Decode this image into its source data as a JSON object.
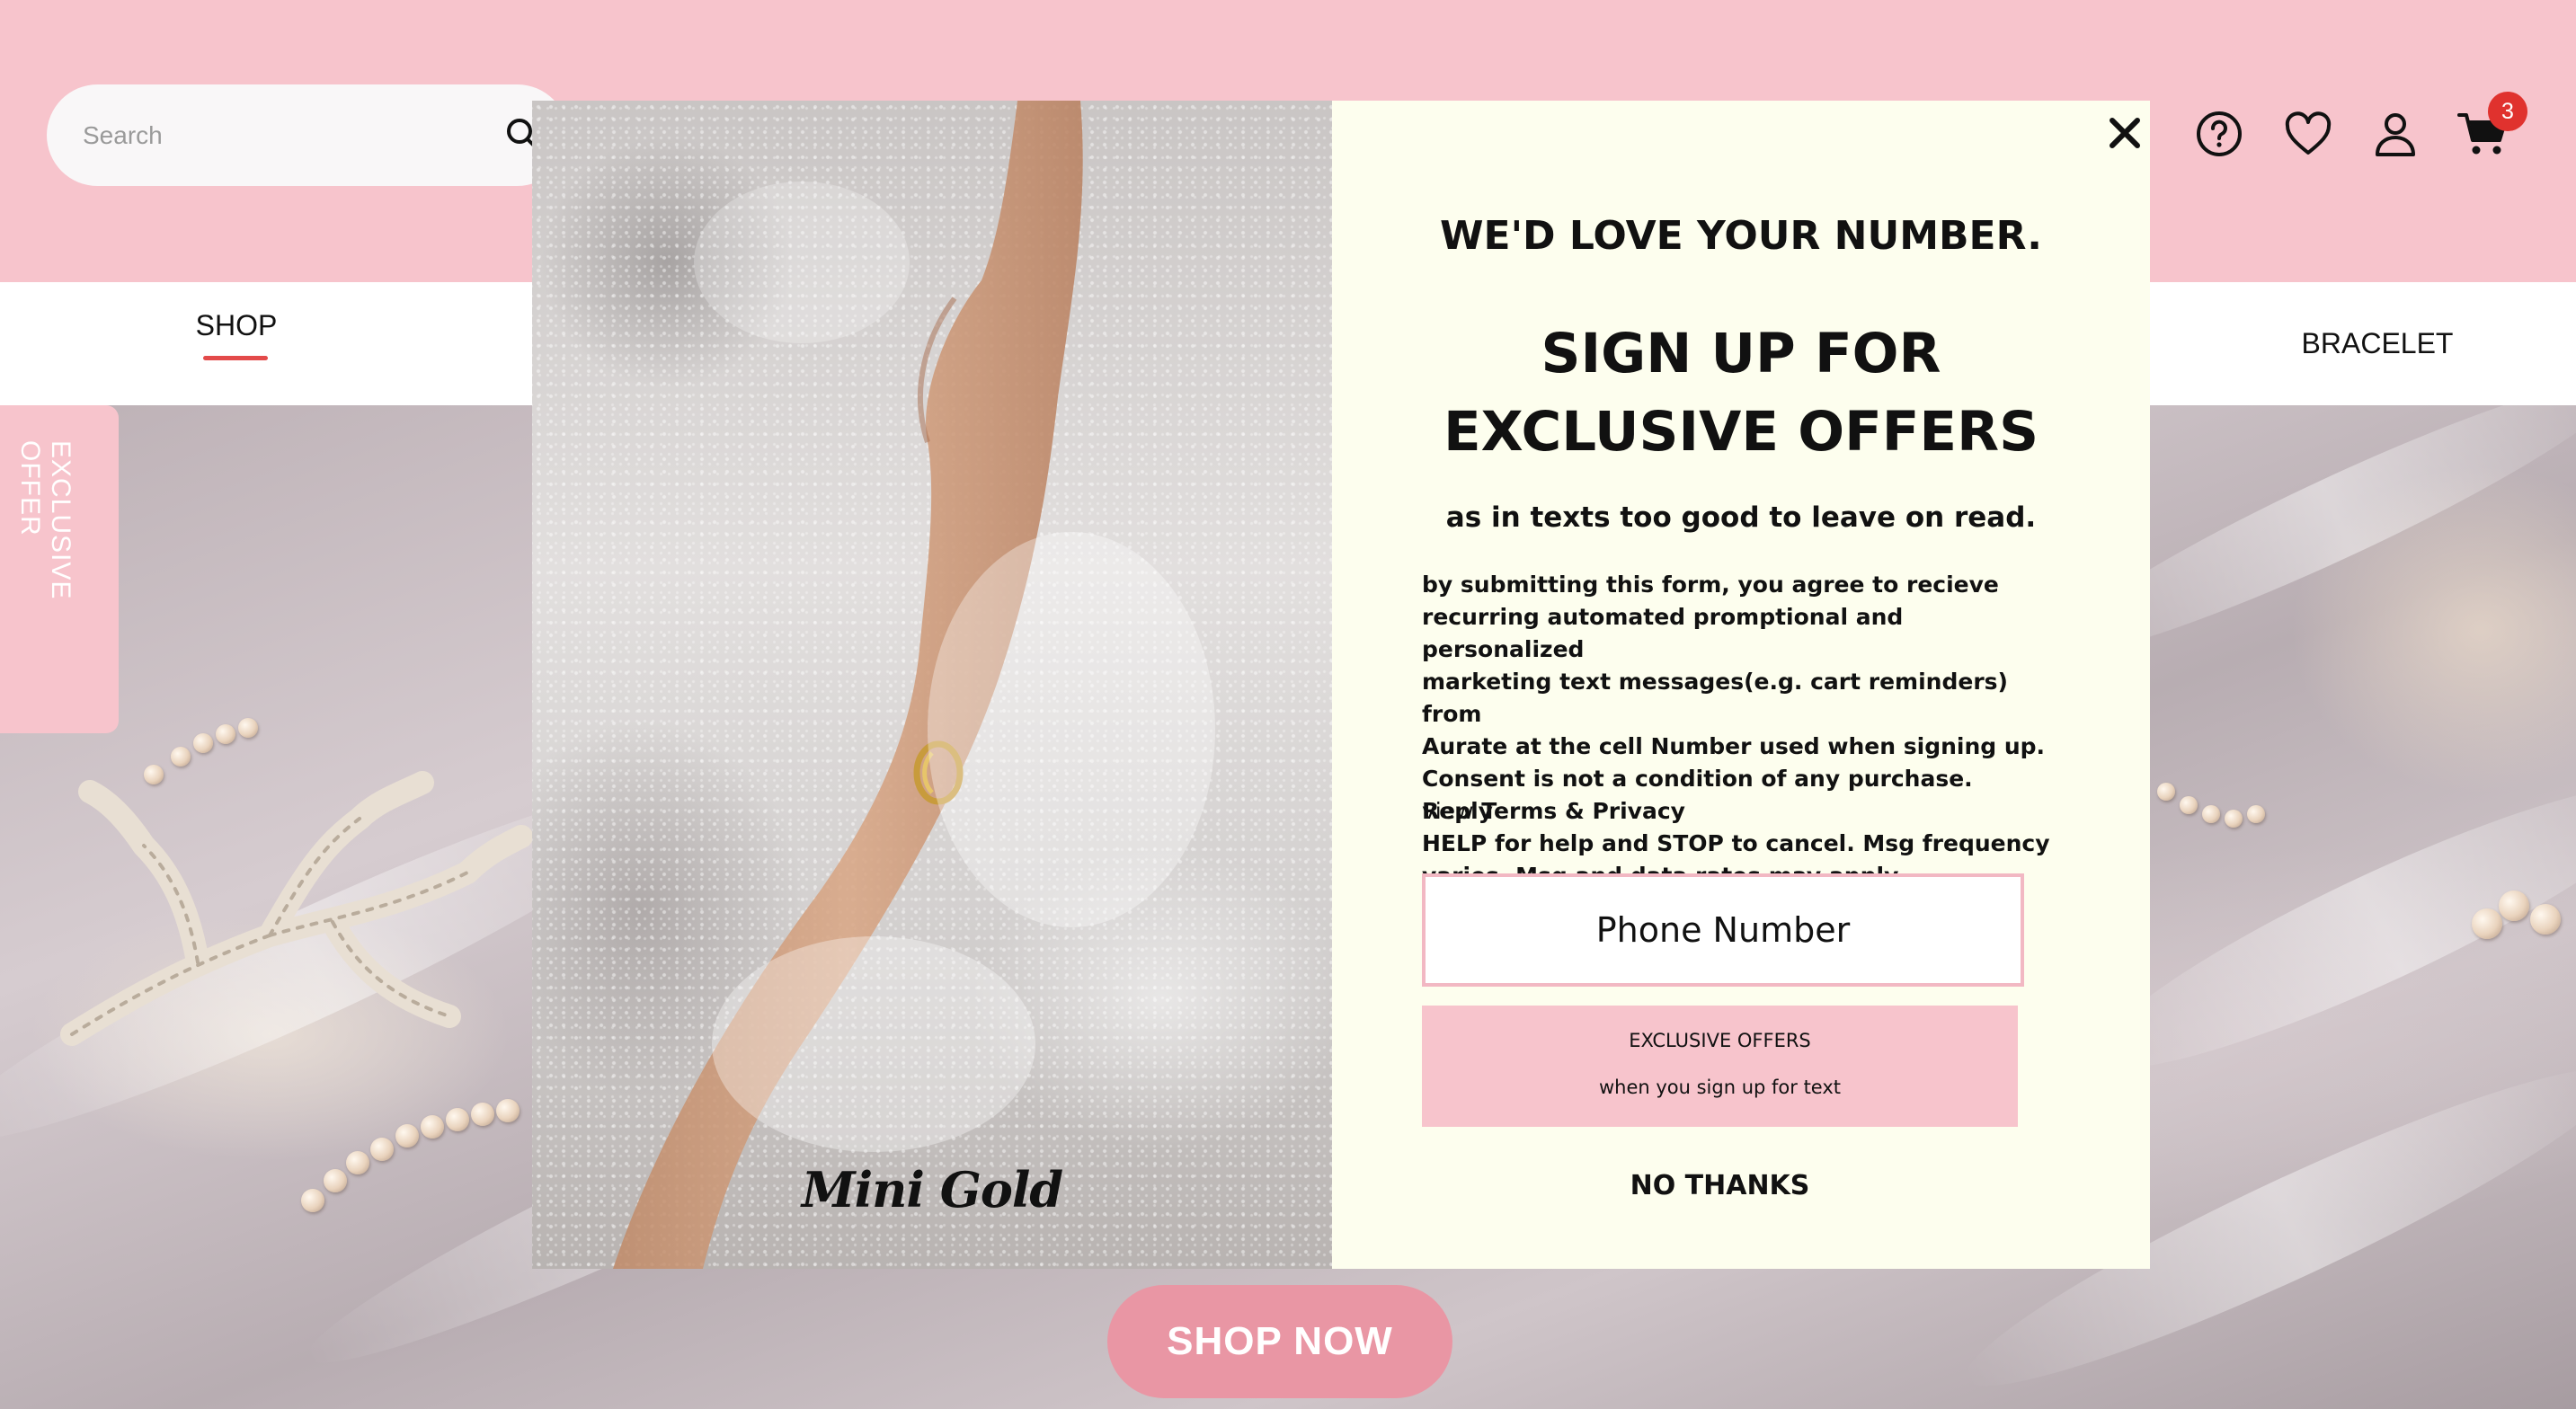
{
  "header": {
    "search_placeholder": "Search",
    "icons": [
      "search-icon",
      "help-icon",
      "heart-icon",
      "user-icon",
      "cart-icon"
    ],
    "cart_count": "3",
    "colors": {
      "background": "#f7c4cc",
      "badge": "#e0322e"
    }
  },
  "nav": {
    "items": [
      {
        "label": "SHOP",
        "active": true
      },
      {
        "label": "BRACELET",
        "active": false
      }
    ],
    "active_underline_color": "#e34a4a"
  },
  "side_tab": {
    "label": "EXCLUSIVE OFFER"
  },
  "hero": {
    "cta_label": "SHOP NOW",
    "cta_color": "#e996a4"
  },
  "modal": {
    "image_caption": "Mini Gold",
    "close_icon": "close-icon",
    "heading": "WE'D LOVE YOUR NUMBER.",
    "title_line1": "SIGN UP FOR",
    "title_line2": "EXCLUSIVE OFFERS",
    "subtitle": "as in texts too good to leave on read.",
    "legal_lines": [
      "by submitting this form, you agree to recieve",
      "recurring automated promptional and personalized",
      "marketing text messages(e.g. cart reminders) from",
      "Aurate at the cell Number used when signing up.",
      "Consent is not a condition of any purchase. Reply",
      "HELP for help and STOP to cancel. Msg frequency",
      "varies. Msg and data rates may apply."
    ],
    "view_label": "view",
    "terms_link": "Terms & Privacy",
    "phone_placeholder": "Phone Number",
    "offer_button_line1": "EXCLUSIVE OFFERS",
    "offer_button_line2": "when you sign up for text",
    "no_thanks": "NO THANKS",
    "colors": {
      "panel": "#fdfeee",
      "button": "#f7c4cc",
      "input_border": "#f2b8c3"
    }
  }
}
